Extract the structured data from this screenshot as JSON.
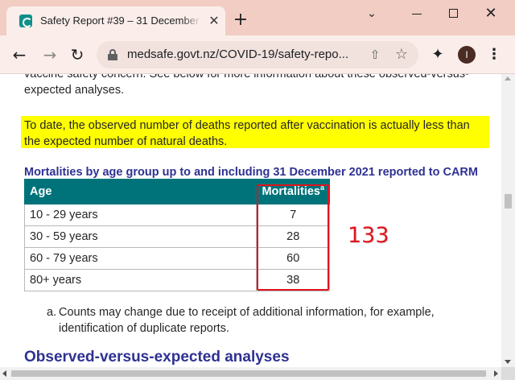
{
  "tab": {
    "title": "Safety Report #39 – 31 December",
    "close_glyph": "✕",
    "favicon": "medsafe-favicon"
  },
  "new_tab_glyph": "+",
  "window_controls": {
    "menu_glyph": "⌄",
    "close_glyph": "✕"
  },
  "toolbar": {
    "back_glyph": "←",
    "forward_glyph": "→",
    "reload_glyph": "↻",
    "url": "medsafe.govt.nz/COVID-19/safety-repo...",
    "share_glyph": "⇧",
    "star_glyph": "☆",
    "extensions_glyph": "✦",
    "avatar_letter": "I",
    "menu_glyph": "⋮"
  },
  "content": {
    "intro": "vaccine safety concern. See below for more information about these observed-versus-expected analyses.",
    "highlight": "To date, the observed number of deaths reported after vaccination is actually less than the expected number of natural deaths.",
    "table_caption": "Mortalities by age group up to and including 31 December 2021 reported to CARM",
    "table": {
      "headers": {
        "age": "Age",
        "mortalities": "Mortalities",
        "mortalities_sup": "a"
      },
      "rows": [
        {
          "age": "10 - 29 years",
          "count": "7"
        },
        {
          "age": "30 - 59 years",
          "count": "28"
        },
        {
          "age": "60 - 79 years",
          "count": "60"
        },
        {
          "age": "80+ years",
          "count": "38"
        }
      ]
    },
    "annotation_total": "133",
    "footnote_marker": "a.",
    "footnote_text": "Counts may change due to receipt of additional information, for example, identification of duplicate reports.",
    "section_heading": "Observed-versus-expected analyses"
  },
  "colors": {
    "tabstrip": "#f2cdc4",
    "highlight": "#ffff00",
    "table_header": "#00737a",
    "heading": "#2e3192",
    "annotation": "#e0141e"
  }
}
